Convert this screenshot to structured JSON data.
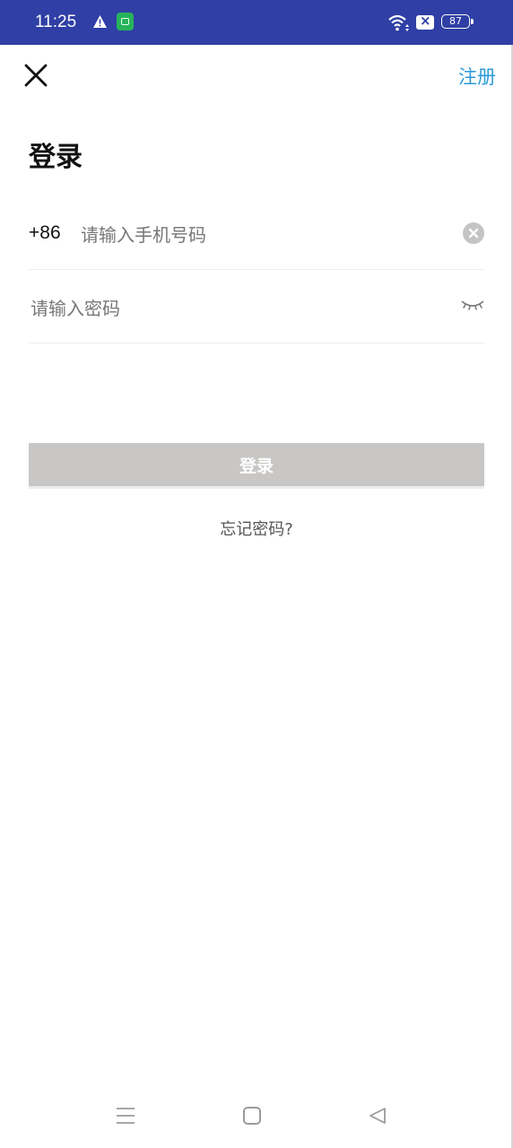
{
  "status_bar": {
    "time": "11:25",
    "battery": "87",
    "icons": [
      "warning-icon",
      "app-notification-icon",
      "wifi-icon",
      "sim-off-icon",
      "battery-icon"
    ],
    "background": "#2f3fa5"
  },
  "header": {
    "close_icon": "close-icon",
    "register_label": "注册"
  },
  "title": "登录",
  "phone": {
    "country_code": "+86",
    "placeholder": "请输入手机号码",
    "value": "",
    "clear_icon": "clear-circle-icon"
  },
  "password": {
    "placeholder": "请输入密码",
    "value": "",
    "visibility_icon": "eye-closed-icon"
  },
  "login_button": {
    "label": "登录",
    "enabled": false,
    "color": "#c8c7c5"
  },
  "forgot_password": "忘记密码?",
  "nav_bar": {
    "icons": [
      "menu-icon",
      "home-icon",
      "back-icon"
    ]
  },
  "accent_color": "#2a9bd6"
}
